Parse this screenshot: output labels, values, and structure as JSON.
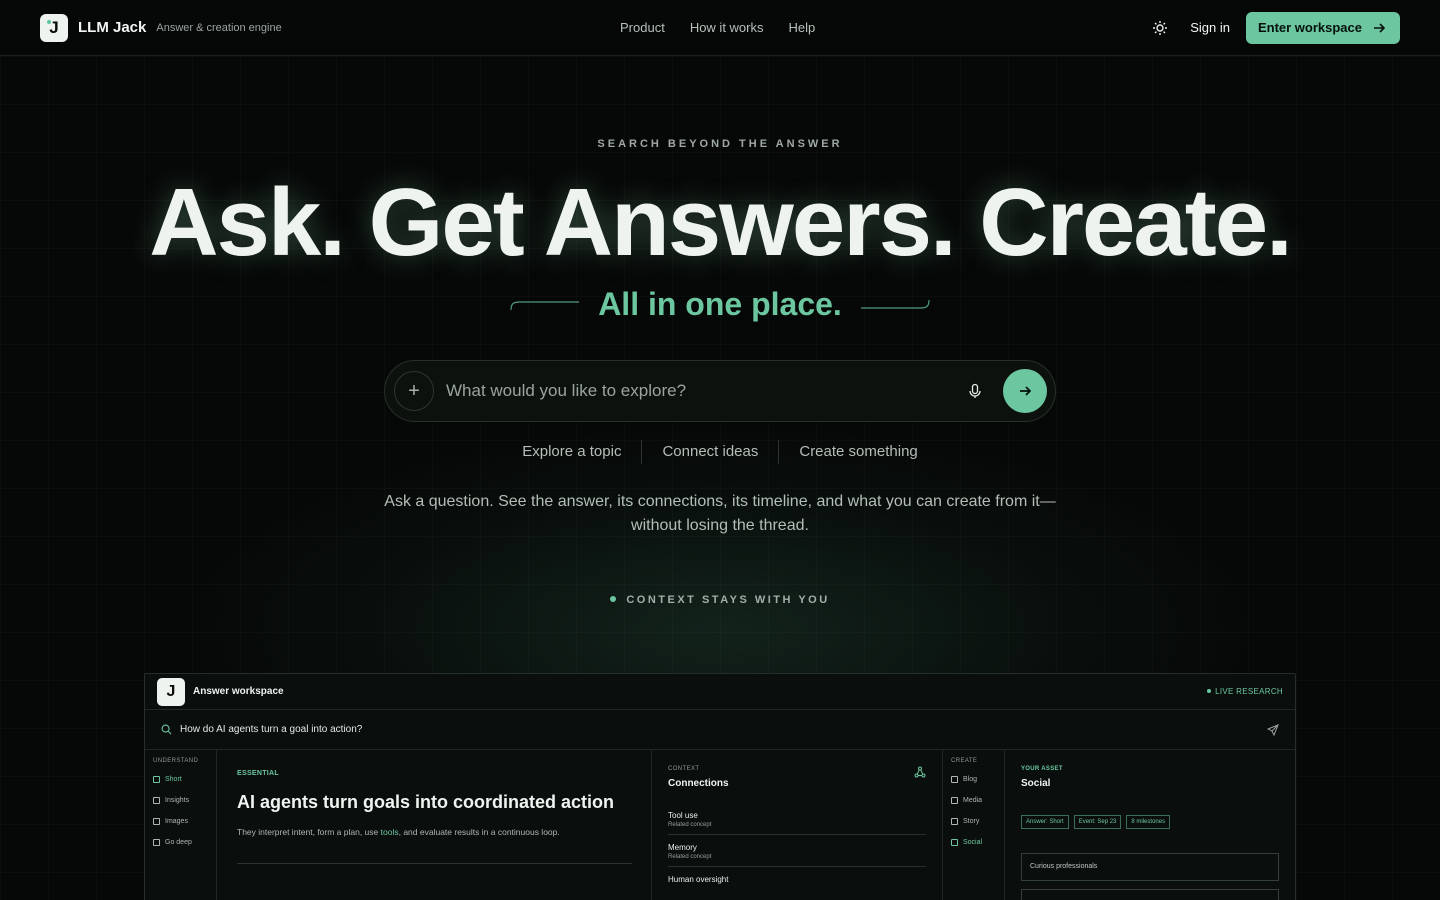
{
  "nav": {
    "brand": "LLM Jack",
    "tagline": "Answer & creation engine",
    "links": [
      "Product",
      "How it works",
      "Help"
    ],
    "sign_in": "Sign in",
    "enter_workspace": "Enter workspace",
    "theme_icon": "sun-icon"
  },
  "hero": {
    "eyebrow": "SEARCH BEYOND THE ANSWER",
    "headline": "Ask. Get Answers. Create.",
    "subline": "All in one place.",
    "search_placeholder": "What would you like to explore?",
    "chips": [
      "Explore a topic",
      "Connect ideas",
      "Create something"
    ],
    "description": "Ask a question. See the answer, its connections, its timeline, and what you can create from it—without losing the thread.",
    "context_label": "CONTEXT STAYS WITH YOU"
  },
  "workspace": {
    "title": "Answer workspace",
    "live": "LIVE RESEARCH",
    "query": "How do AI agents turn a goal into action?",
    "understand_label": "UNDERSTAND",
    "understand_items": [
      "Short",
      "Insights",
      "Images",
      "Go deep"
    ],
    "essential_label": "ESSENTIAL",
    "main_heading": "AI agents turn goals into coordinated action",
    "main_text_before": "They interpret intent, form a plan, use ",
    "main_text_link": "tools",
    "main_text_after": ", and evaluate results in a continuous loop.",
    "context_label": "CONTEXT",
    "connections_title": "Connections",
    "connections": [
      {
        "name": "Tool use",
        "sub": "Related concept"
      },
      {
        "name": "Memory",
        "sub": "Related concept"
      },
      {
        "name": "Human oversight",
        "sub": ""
      }
    ],
    "create_label": "CREATE",
    "create_items": [
      "Blog",
      "Media",
      "Story",
      "Social"
    ],
    "asset_label": "YOUR ASSET",
    "asset_title": "Social",
    "tags": [
      "Answer: Short",
      "Event: Sep 23",
      "8 milestones"
    ],
    "audience": "Curious professionals"
  },
  "colors": {
    "accent": "#6cc7a0",
    "background": "#060807",
    "text": "#eef3ef"
  }
}
